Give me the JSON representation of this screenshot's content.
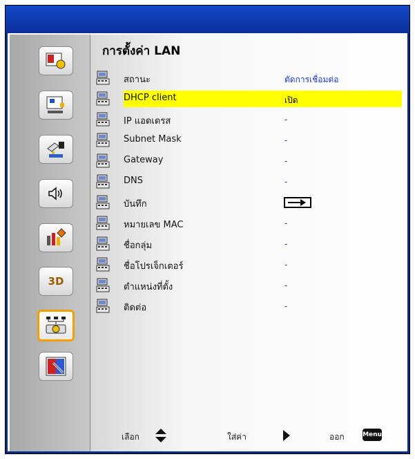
{
  "menu": {
    "title": "การตั้งค่า LAN",
    "rows": [
      {
        "label": "สถานะ",
        "value": "ตัดการเชื่อมต่อ",
        "selected": false
      },
      {
        "label": "DHCP client",
        "value": "เปิด",
        "selected": true
      },
      {
        "label": "IP แอดเดรส",
        "value": "-",
        "selected": false
      },
      {
        "label": "Subnet Mask",
        "value": "-",
        "selected": false
      },
      {
        "label": "Gateway",
        "value": "-",
        "selected": false
      },
      {
        "label": "DNS",
        "value": "-",
        "selected": false
      },
      {
        "label": "บันทึก",
        "value": "",
        "selected": false
      },
      {
        "label": "หมายเลข MAC",
        "value": "-",
        "selected": false
      },
      {
        "label": "ชื่อกลุ่ม",
        "value": "-",
        "selected": false
      },
      {
        "label": "ชื่อโปรเจ็กเตอร์",
        "value": "-",
        "selected": false
      },
      {
        "label": "ตำแหน่งที่ตั้ง",
        "value": "-",
        "selected": false
      },
      {
        "label": "ติดต่อ",
        "value": "-",
        "selected": false
      }
    ]
  },
  "sidebar": {
    "items": [
      {
        "icon": "image-settings-icon"
      },
      {
        "icon": "display-icon"
      },
      {
        "icon": "setup-icon"
      },
      {
        "icon": "audio-icon"
      },
      {
        "icon": "options-icon"
      },
      {
        "icon": "3d-icon",
        "text": "3D"
      },
      {
        "icon": "lan-icon",
        "selected": true
      },
      {
        "icon": "interactive-icon"
      }
    ]
  },
  "footer": {
    "select_label": "เลือก",
    "enter_label": "ใส่ค่า",
    "exit_label": "ออก",
    "menu_key": "Menu"
  },
  "colors": {
    "frame": "#0a2a8a",
    "highlight": "#ffff00",
    "value_text": "#1a3ad0",
    "sidebar_selected_border": "#f5a000"
  }
}
